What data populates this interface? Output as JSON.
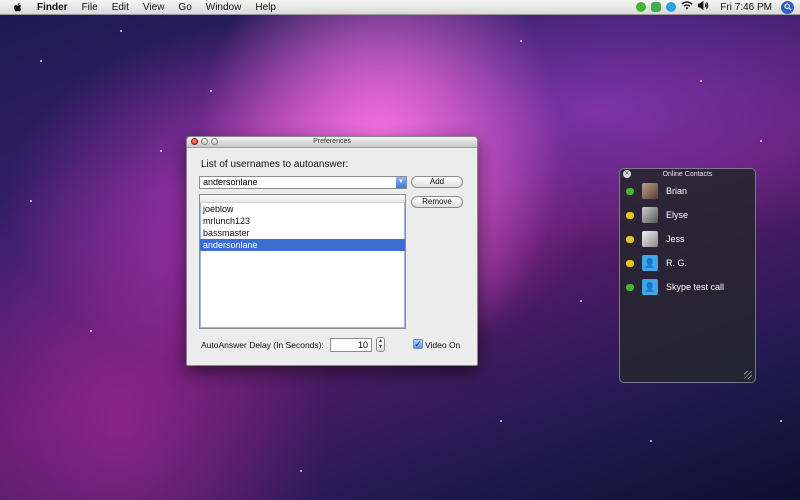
{
  "menubar": {
    "menus": [
      "Finder",
      "File",
      "Edit",
      "View",
      "Go",
      "Window",
      "Help"
    ],
    "clock": "Fri 7:46 PM",
    "status_icons": [
      "skype-status-icon",
      "chat-icon",
      "skype-icon",
      "wifi-icon",
      "volume-icon",
      "spotlight-icon"
    ]
  },
  "preferences": {
    "title": "Preferences",
    "heading": "List of usernames to autoanswer:",
    "combo_value": "andersonlane",
    "add_label": "Add",
    "remove_label": "Remove",
    "usernames": [
      "joeblow",
      "mrlunch123",
      "bassmaster",
      "andersonlane"
    ],
    "selected_index": 3,
    "delay_label": "AutoAnswer Delay (In Seconds):",
    "delay_value": "10",
    "video_label": "Video On",
    "video_checked": true
  },
  "contacts": {
    "title": "Online Contacts",
    "items": [
      {
        "name": "Brian",
        "status": "online",
        "avatar": "photo-avatar"
      },
      {
        "name": "Elyse",
        "status": "away",
        "avatar": "photo-avatar"
      },
      {
        "name": "Jess",
        "status": "away",
        "avatar": "photo-avatar"
      },
      {
        "name": "R. G.",
        "status": "away",
        "avatar": "default-avatar"
      },
      {
        "name": "Skype test call",
        "status": "online",
        "avatar": "default-avatar"
      }
    ]
  },
  "colors": {
    "online": "#43b52f",
    "away": "#e8c21f",
    "selection": "#3a6fd0",
    "default_avatar": "#3fa6e8"
  }
}
